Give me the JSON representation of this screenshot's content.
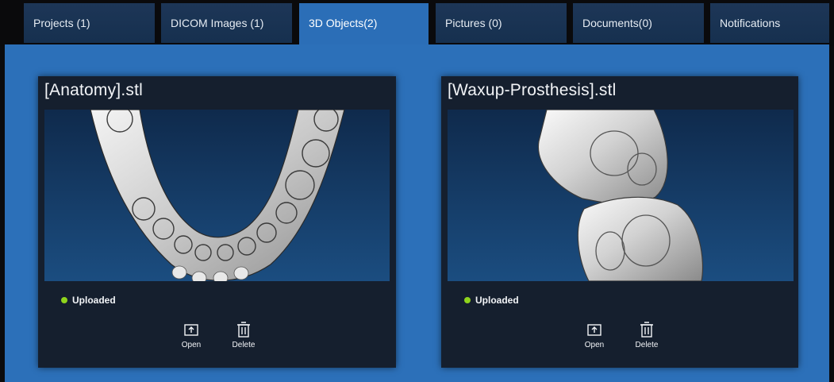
{
  "tabs": [
    {
      "label": "Projects (1)",
      "active": false
    },
    {
      "label": "DICOM Images (1)",
      "active": false
    },
    {
      "label": "3D Objects(2)",
      "active": true
    },
    {
      "label": "Pictures (0)",
      "active": false
    },
    {
      "label": "Documents(0)",
      "active": false
    },
    {
      "label": "Notifications",
      "active": false
    }
  ],
  "cards": [
    {
      "title": "[Anatomy].stl",
      "preview": "jaw-arch-3d-model",
      "status": "Uploaded",
      "status_color": "#8fd41c",
      "open_label": "Open",
      "delete_label": "Delete"
    },
    {
      "title": "[Waxup-Prosthesis].stl",
      "preview": "crown-prosthesis-3d-model",
      "status": "Uploaded",
      "status_color": "#8fd41c",
      "open_label": "Open",
      "delete_label": "Delete"
    }
  ],
  "colors": {
    "tab_bg": "#1d3657",
    "tab_active": "#2b6eb7",
    "content_bg": "#2c70b9",
    "card_bg": "#151f2e",
    "preview_bg": "#1b4d80"
  }
}
